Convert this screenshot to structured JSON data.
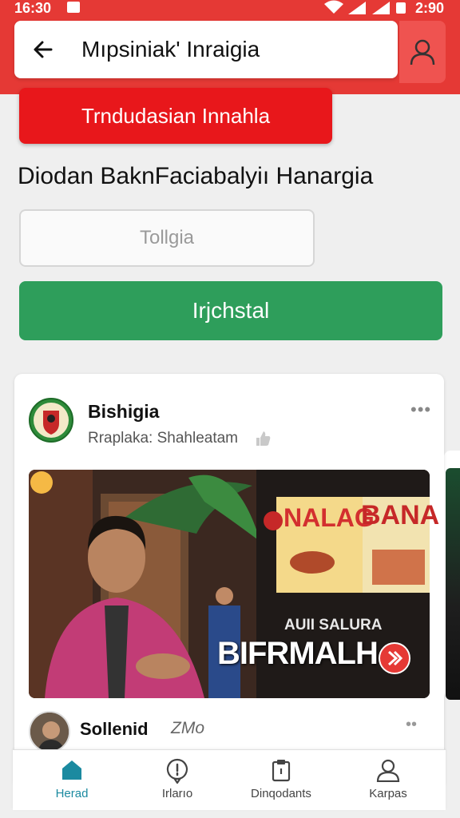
{
  "status_bar": {
    "time": "16:30",
    "battery": "2:90"
  },
  "header": {
    "back_icon": "arrow-left-icon",
    "title": "Mıpsiniak' Inraigia",
    "profile_icon": "user-icon"
  },
  "banner_button": "Trndudasian Innahla",
  "heading": "Diodan BaknFaciabalyiı Hanargia",
  "input": {
    "placeholder": "Tollgia"
  },
  "primary_button": "Irjchstal",
  "post": {
    "author": "Bishigia",
    "meta": "Rraplaka: Shahleatam",
    "sign_left": "NALAG",
    "sign_right": "BANA",
    "sign_mid": "AUII SALURA",
    "caption": "BIFRMALH",
    "comment": {
      "author": "Sollenid",
      "meta": "ZMo"
    }
  },
  "bottom_nav": [
    {
      "label": "Herad",
      "icon": "home-icon",
      "active": true
    },
    {
      "label": "Irlarıo",
      "icon": "info-icon",
      "active": false
    },
    {
      "label": "Dinqodants",
      "icon": "clipboard-icon",
      "active": false
    },
    {
      "label": "Karpas",
      "icon": "profile-icon",
      "active": false
    }
  ],
  "colors": {
    "header": "#e53935",
    "banner": "#e8171b",
    "primary": "#2e9e5b",
    "nav_active": "#1b8aa0"
  }
}
